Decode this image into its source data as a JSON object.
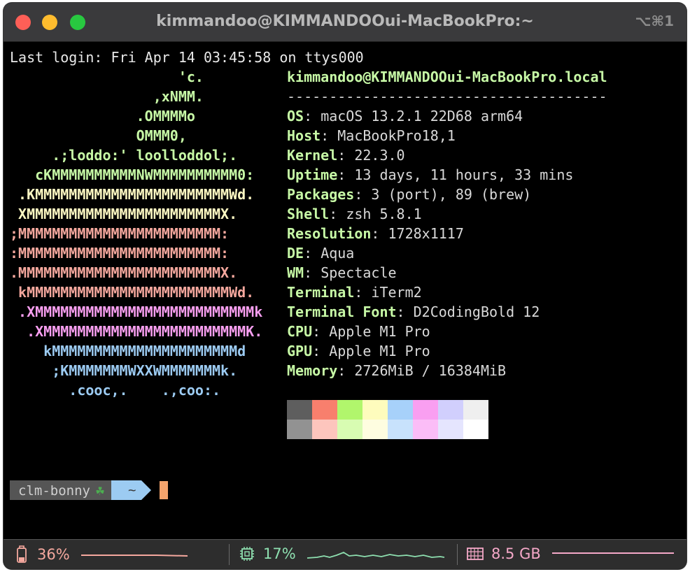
{
  "window": {
    "title": "kimmandoo@KIMMANDOOui-MacBookPro:~",
    "shortcut": "⌥⌘1"
  },
  "terminal": {
    "last_login": "Last login: Fri Apr 14 03:45:58 on ttys000",
    "logo_lines": [
      {
        "text": "                    'c.",
        "color": "#c7f9a6"
      },
      {
        "text": "                 ,xNMM.",
        "color": "#c7f9a6"
      },
      {
        "text": "               .OMMMMo",
        "color": "#c7f9a6"
      },
      {
        "text": "               OMMM0,",
        "color": "#c7f9a6"
      },
      {
        "text": "     .;loddo:' loolloddol;.",
        "color": "#c7f9a6"
      },
      {
        "text": "   cKMMMMMMMMMMNWMMMMMMMMMM0:",
        "color": "#c7f9a6"
      },
      {
        "text": " .KMMMMMMMMMMMMMMMMMMMMMMMWd.",
        "color": "#fef9c3"
      },
      {
        "text": " XMMMMMMMMMMMMMMMMMMMMMMMX.",
        "color": "#fef9c3"
      },
      {
        "text": ";MMMMMMMMMMMMMMMMMMMMMMMM:",
        "color": "#f5a89e"
      },
      {
        "text": ":MMMMMMMMMMMMMMMMMMMMMMMM:",
        "color": "#f5a89e"
      },
      {
        "text": ".MMMMMMMMMMMMMMMMMMMMMMMMX.",
        "color": "#f5a89e"
      },
      {
        "text": " kMMMMMMMMMMMMMMMMMMMMMMMMWd.",
        "color": "#f5a89e"
      },
      {
        "text": " .XMMMMMMMMMMMMMMMMMMMMMMMMMMk",
        "color": "#f99ff1"
      },
      {
        "text": "  .XMMMMMMMMMMMMMMMMMMMMMMMMK.",
        "color": "#f99ff1"
      },
      {
        "text": "    kMMMMMMMMMMMMMMMMMMMMMMd",
        "color": "#9ccbf2"
      },
      {
        "text": "     ;KMMMMMMMWXXWMMMMMMMk.",
        "color": "#9ccbf2"
      },
      {
        "text": "       .cooc,.    .,coo:.",
        "color": "#9ccbf2"
      }
    ],
    "host_header": "kimmandoo@KIMMANDOOui-MacBookPro.local",
    "separator": "--------------------------------------",
    "info": [
      {
        "key": "OS",
        "value": "macOS 13.2.1 22D68 arm64"
      },
      {
        "key": "Host",
        "value": "MacBookPro18,1"
      },
      {
        "key": "Kernel",
        "value": "22.3.0"
      },
      {
        "key": "Uptime",
        "value": "13 days, 11 hours, 33 mins"
      },
      {
        "key": "Packages",
        "value": "3 (port), 89 (brew)"
      },
      {
        "key": "Shell",
        "value": "zsh 5.8.1"
      },
      {
        "key": "Resolution",
        "value": "1728x1117"
      },
      {
        "key": "DE",
        "value": "Aqua"
      },
      {
        "key": "WM",
        "value": "Spectacle"
      },
      {
        "key": "Terminal",
        "value": "iTerm2"
      },
      {
        "key": "Terminal Font",
        "value": "D2CodingBold 12"
      },
      {
        "key": "CPU",
        "value": "Apple M1 Pro"
      },
      {
        "key": "GPU",
        "value": "Apple M1 Pro"
      },
      {
        "key": "Memory",
        "value": "2726MiB / 16384MiB"
      }
    ],
    "palette_top": [
      "#5e5e5e",
      "#f87f6d",
      "#b1f66c",
      "#fefcbd",
      "#a7d1fa",
      "#f99ff1",
      "#d1cffd",
      "#efefef"
    ],
    "palette_bottom": [
      "#929292",
      "#fdc5bd",
      "#d8fcb2",
      "#fefde0",
      "#c8e2fc",
      "#fbbdf7",
      "#e5e5fe",
      "#ffffff"
    ],
    "prompt": {
      "user": "clm-bonny",
      "icon": "clover-icon",
      "dir": "~"
    }
  },
  "statusbar": {
    "battery": {
      "value": "36%",
      "color": "#f5a89e",
      "level": 0.36
    },
    "cpu": {
      "value": "17%",
      "color": "#8ee0b0",
      "level": 0.17
    },
    "memory": {
      "value": "8.5 GB",
      "color": "#f5a8c8"
    }
  }
}
